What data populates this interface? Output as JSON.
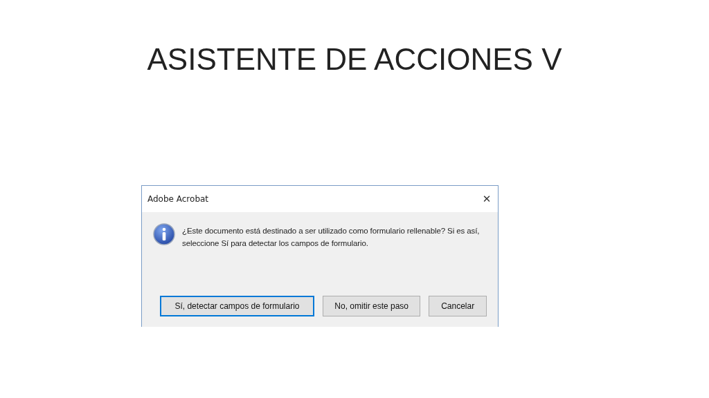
{
  "slide": {
    "title": "ASISTENTE DE ACCIONES V"
  },
  "dialog": {
    "title": "Adobe Acrobat",
    "close": "✕",
    "message": "¿Este documento está destinado a ser utilizado como formulario rellenable? Si es así,\nseleccione Sí para detectar los campos de formulario.",
    "buttons": [
      {
        "label": "Sí, detectar campos de formulario",
        "focused": true
      },
      {
        "label": "No, omitir este paso",
        "focused": false
      },
      {
        "label": "Cancelar",
        "focused": false
      }
    ]
  }
}
